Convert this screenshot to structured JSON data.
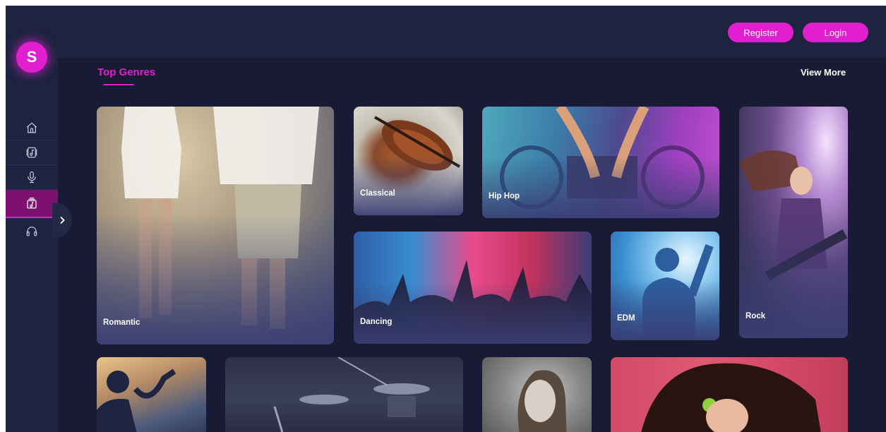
{
  "brand": {
    "logo_letter": "S",
    "accent_color": "#e21fd0",
    "background": "#181b33"
  },
  "header": {
    "register_label": "Register",
    "login_label": "Login"
  },
  "sidebar": {
    "items": [
      {
        "icon": "home-icon",
        "active": false
      },
      {
        "icon": "music-note-box-icon",
        "active": false
      },
      {
        "icon": "microphone-icon",
        "active": false
      },
      {
        "icon": "album-icon",
        "active": true
      },
      {
        "icon": "headphones-icon",
        "active": false
      }
    ],
    "expander_icon": "chevron-right-icon"
  },
  "section": {
    "title": "Top Genres",
    "view_more": "View More"
  },
  "genres": [
    {
      "label": "Romantic"
    },
    {
      "label": "Classical"
    },
    {
      "label": "Hip Hop"
    },
    {
      "label": "Rock"
    },
    {
      "label": "Dancing"
    },
    {
      "label": "EDM"
    }
  ],
  "row2_cards": [
    {
      "image": "saxophone-player"
    },
    {
      "image": "drum-kit"
    },
    {
      "image": "portrait"
    },
    {
      "image": "curly-hair-headphones"
    }
  ]
}
